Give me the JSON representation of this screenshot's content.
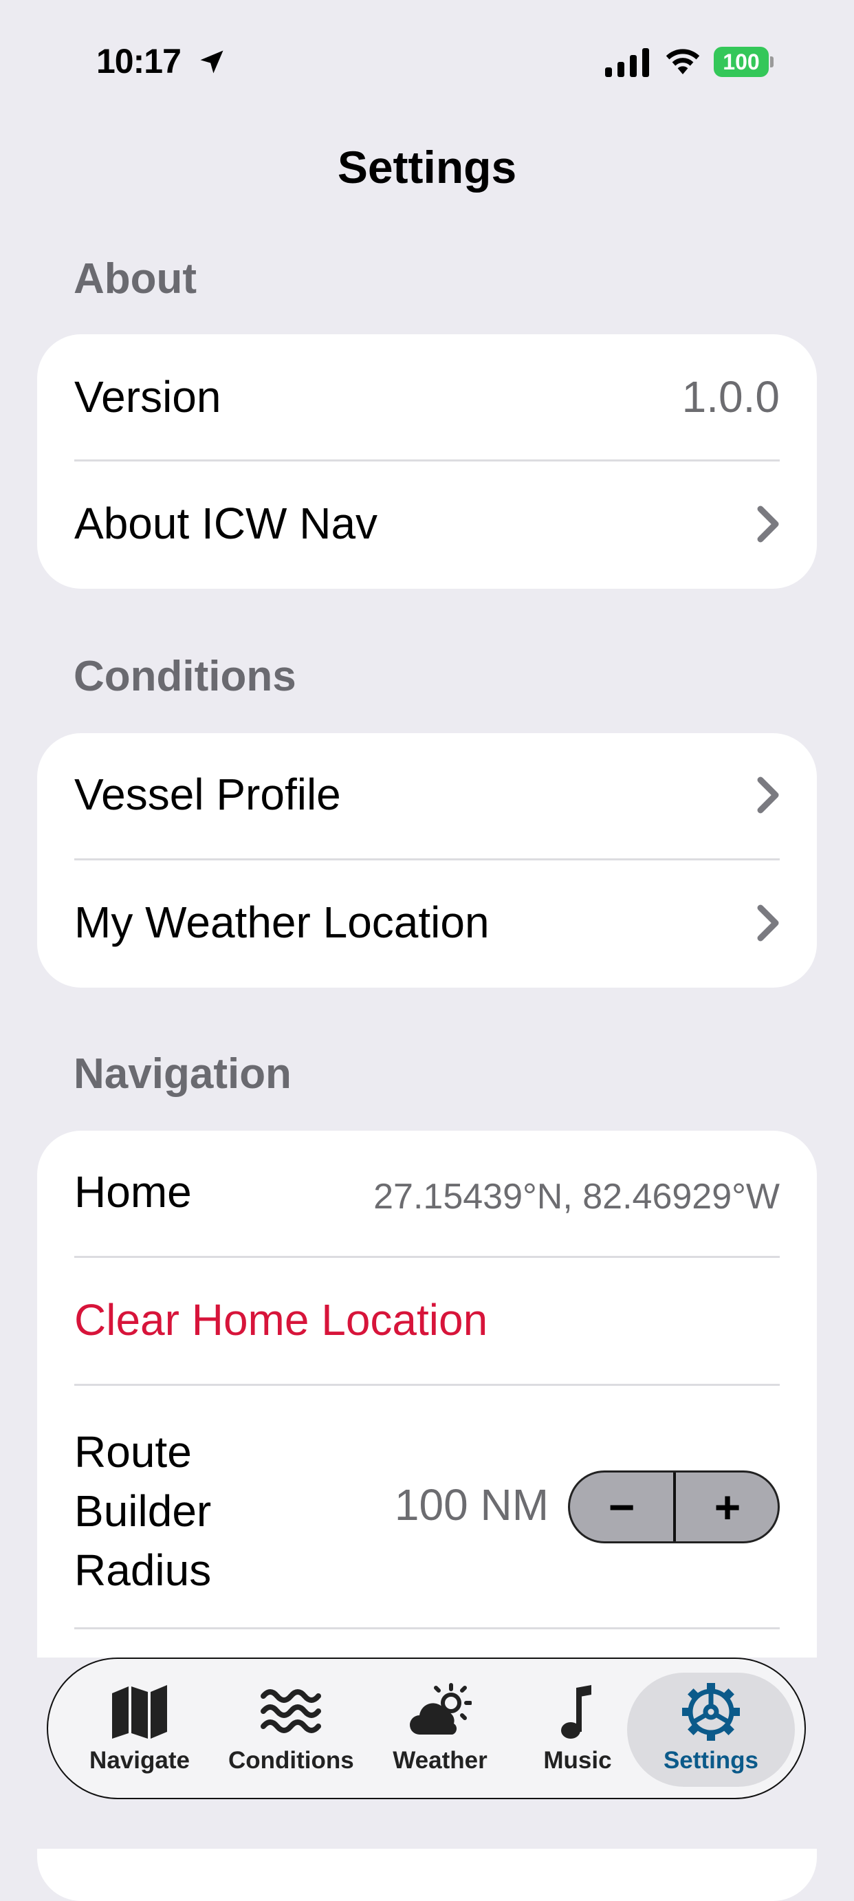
{
  "status_bar": {
    "time": "10:17",
    "location_icon": "location-arrow-icon",
    "signal_icon": "cellular-signal-icon",
    "wifi_icon": "wifi-icon",
    "battery_level": "100",
    "battery_color": "#34C759"
  },
  "page": {
    "title": "Settings"
  },
  "sections": {
    "about": {
      "header": "About",
      "version_label": "Version",
      "version_value": "1.0.0",
      "about_label": "About ICW Nav"
    },
    "conditions": {
      "header": "Conditions",
      "vessel_profile_label": "Vessel Profile",
      "weather_location_label": "My Weather Location"
    },
    "navigation": {
      "header": "Navigation",
      "home_label": "Home",
      "home_value": "27.15439°N, 82.46929°W",
      "clear_home_label": "Clear Home Location",
      "clear_home_color": "#D7143A",
      "radius_label_line1": "Route",
      "radius_label_line2": "Builder",
      "radius_label_line3": "Radius",
      "radius_value": "100 NM",
      "stepper_minus": "−",
      "stepper_plus": "+"
    }
  },
  "tab_bar": {
    "accent_color": "#0B5A8A",
    "tabs": [
      {
        "label": "Navigate",
        "icon": "map-icon"
      },
      {
        "label": "Conditions",
        "icon": "waves-icon"
      },
      {
        "label": "Weather",
        "icon": "cloud-sun-icon"
      },
      {
        "label": "Music",
        "icon": "music-note-icon"
      },
      {
        "label": "Settings",
        "icon": "gear-icon",
        "selected": true
      }
    ]
  }
}
